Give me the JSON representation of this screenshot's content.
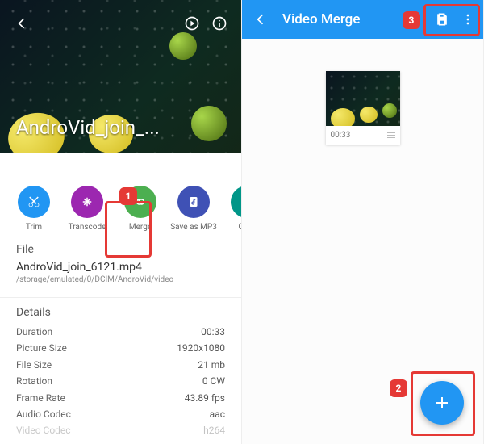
{
  "left": {
    "hero_title": "AndroVid_join_...",
    "actions": {
      "trim": "Trim",
      "transcode": "Transcode",
      "merge": "Merge",
      "save_mp3": "Save as MP3",
      "grab": "Grab"
    },
    "file": {
      "heading": "File",
      "name": "AndroVid_join_6121.mp4",
      "path": "/storage/emulated/0/DCIM/AndroVid/video"
    },
    "details": {
      "heading": "Details",
      "duration_label": "Duration",
      "duration": "00:33",
      "picsize_label": "Picture Size",
      "picsize": "1920x1080",
      "filesize_label": "File Size",
      "filesize": "21 mb",
      "rotation_label": "Rotation",
      "rotation": "0 CW",
      "fps_label": "Frame Rate",
      "fps": "43.89 fps",
      "acodec_label": "Audio Codec",
      "acodec": "aac",
      "vcodec_label": "Video Codec",
      "vcodec": "h264"
    }
  },
  "right": {
    "title": "Video Merge",
    "thumb_duration": "00:33"
  },
  "callouts": {
    "one": "1",
    "two": "2",
    "three": "3"
  }
}
